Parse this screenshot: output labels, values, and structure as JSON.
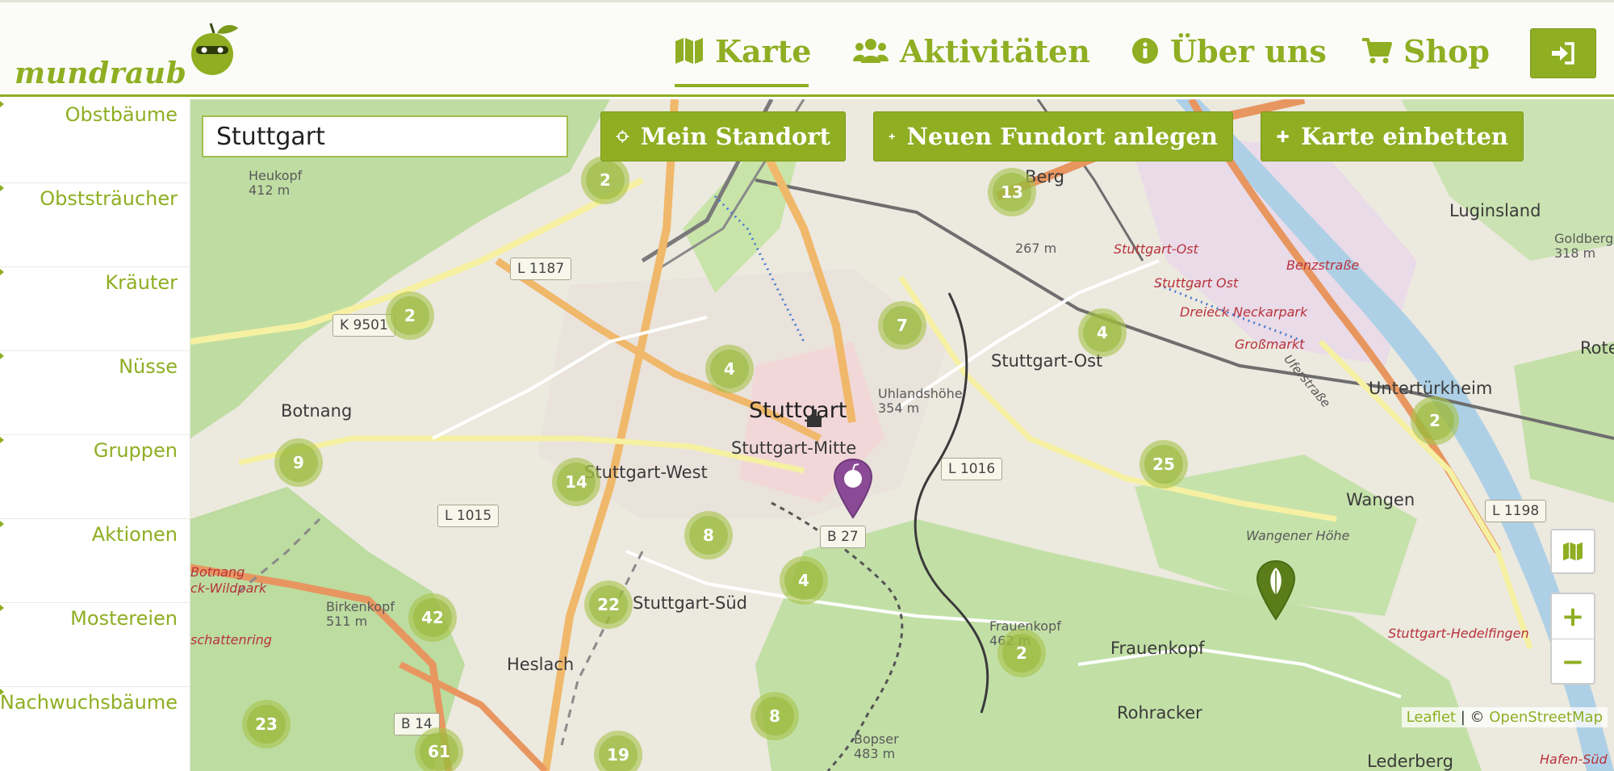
{
  "app": {
    "logo_text": "mundraub"
  },
  "nav": {
    "items": [
      {
        "label": "Karte",
        "icon": "map-icon",
        "active": true
      },
      {
        "label": "Aktivitäten",
        "icon": "users-icon"
      },
      {
        "label": "Über uns",
        "icon": "info-circle-icon"
      },
      {
        "label": "Shop",
        "icon": "shopping-cart-icon"
      }
    ],
    "login_icon": "sign-in-icon"
  },
  "sidebar": {
    "items": [
      {
        "label": "Obstbäume"
      },
      {
        "label": "Obststräucher"
      },
      {
        "label": "Kräuter"
      },
      {
        "label": "Nüsse"
      },
      {
        "label": "Gruppen"
      },
      {
        "label": "Aktionen"
      },
      {
        "label": "Mostereien"
      },
      {
        "label": "Nachwuchsbäume"
      }
    ]
  },
  "toolbar": {
    "search_value": "Stuttgart",
    "my_location": "Mein Standort",
    "new_location": "Neuen Fundort anlegen",
    "embed_map": "Karte einbetten"
  },
  "map": {
    "labels": {
      "stuttgart": "Stuttgart",
      "stuttgart_mitte": "Stuttgart-Mitte",
      "stuttgart_west": "Stuttgart-West",
      "stuttgart_sued": "Stuttgart-Süd",
      "stuttgart_ost": "Stuttgart-Ost",
      "botnang": "Botnang",
      "heslach": "Heslach",
      "frauenkopf": "Frauenkopf",
      "rohracker": "Rohracker",
      "wangen": "Wangen",
      "untertuerkheim": "Untertürkheim",
      "luginsland": "Luginsland",
      "lederberg": "Lederberg",
      "berg": "Berg",
      "heukopf": "Heukopf",
      "heukopf_alt": "412 m",
      "birkenkopf": "Birkenkopf",
      "birkenkopf_alt": "511 m",
      "uhlandshoehe": "Uhlandshöhe",
      "uhlandshoehe_alt": "354 m",
      "frauenkopf_peak": "Frauenkopf",
      "frauenkopf_alt": "462 m",
      "wangener_hoehe": "Wangener Höhe",
      "bopser": "Bopser",
      "bopser_alt": "483 m",
      "goldberg": "Goldberg",
      "goldberg_alt": "318 m",
      "berg_alt": "267 m",
      "stuttgart_ost_station_1": "Stuttgart-Ost",
      "stuttgart_ost_station_2": "Stuttgart Ost",
      "dreieck_neckarpark": "Dreieck Neckarpark",
      "grossmarkt": "Großmarkt",
      "benzstrasse": "Benzstraße",
      "ufer_strasse": "Uferstraße",
      "hedelfingen": "Stuttgart-Hedelfingen",
      "botnang_cut": "Botnang",
      "wildpark_cut": "ck-Wildpark",
      "rotenberg_cut": "Rote",
      "hafen_sued_cut": "Hafen-Süd",
      "schattenring_cut": "schattenring"
    },
    "road_badges": [
      "L 1187",
      "K 9501",
      "L 1015",
      "L 1016",
      "B 27",
      "B 14",
      "L 1198"
    ],
    "clusters": [
      {
        "count": "2"
      },
      {
        "count": "13"
      },
      {
        "count": "2"
      },
      {
        "count": "4"
      },
      {
        "count": "7"
      },
      {
        "count": "4"
      },
      {
        "count": "9"
      },
      {
        "count": "14"
      },
      {
        "count": "25"
      },
      {
        "count": "2"
      },
      {
        "count": "8"
      },
      {
        "count": "4"
      },
      {
        "count": "22"
      },
      {
        "count": "42"
      },
      {
        "count": "2"
      },
      {
        "count": "23"
      },
      {
        "count": "8"
      },
      {
        "count": "61"
      },
      {
        "count": "19"
      }
    ],
    "colors": {
      "brand": "#8fae22",
      "cluster": "#a8c44c",
      "marker_purple": "#8a4a96",
      "marker_green": "#5a7d1a"
    }
  },
  "controls": {
    "zoom_in": "+",
    "zoom_out": "−",
    "layers_icon": "map-layers-icon"
  },
  "attribution": {
    "leaflet": "Leaflet",
    "separator": "| ©",
    "osm": "OpenStreetMap"
  }
}
